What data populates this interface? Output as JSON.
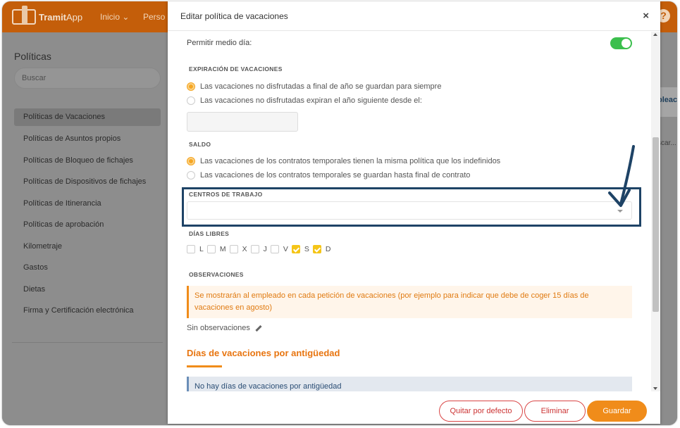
{
  "app": {
    "logo_text": "Tramit",
    "logo_text_suffix": "App",
    "nav": [
      "Inicio",
      "Perso"
    ],
    "help_icon": "question-icon"
  },
  "sidebar": {
    "title": "Políticas",
    "search_placeholder": "Buscar",
    "items": [
      {
        "label": "Políticas de Vacaciones",
        "active": true
      },
      {
        "label": "Políticas de Asuntos propios"
      },
      {
        "label": "Políticas de Bloqueo de fichajes"
      },
      {
        "label": "Políticas de Dispositivos de fichajes"
      },
      {
        "label": "Políticas de Itinerancia"
      },
      {
        "label": "Políticas de aprobación"
      },
      {
        "label": "Kilometraje"
      },
      {
        "label": "Gastos"
      },
      {
        "label": "Dietas"
      },
      {
        "label": "Firma y Certificación electrónica"
      }
    ]
  },
  "background_right": {
    "peek1": "pleac",
    "peek2": "scar..."
  },
  "modal": {
    "title": "Editar política de vacaciones",
    "close": "×",
    "medio_dia_label": "Permitir medio día:",
    "medio_dia_enabled": true,
    "expiracion": {
      "label": "EXPIRACIÓN DE VACACIONES",
      "option1": "Las vacaciones no disfrutadas a final de año se guardan para siempre",
      "option2": "Las vacaciones no disfrutadas expiran el año siguiente desde el:",
      "selected": 1,
      "date_value": ""
    },
    "saldo": {
      "label": "SALDO",
      "option1": "Las vacaciones de los contratos temporales tienen la misma política que los indefinidos",
      "option2": "Las vacaciones de los contratos temporales se guardan hasta final de contrato",
      "selected": 1
    },
    "centros": {
      "label": "CENTROS DE TRABAJO",
      "value": ""
    },
    "dias_libres": {
      "label": "DÍAS LIBRES",
      "days": [
        {
          "label": "L",
          "checked": false
        },
        {
          "label": "M",
          "checked": false
        },
        {
          "label": "X",
          "checked": false
        },
        {
          "label": "J",
          "checked": false
        },
        {
          "label": "V",
          "checked": false
        },
        {
          "label": "S",
          "checked": true
        },
        {
          "label": "D",
          "checked": true
        }
      ]
    },
    "observaciones": {
      "label": "OBSERVACIONES",
      "info": "Se mostrarán al empleado en cada petición de vacaciones (por ejemplo para indicar que debe de coger 15 días de vacaciones en agosto)",
      "value": "Sin observaciones"
    },
    "antiguedad": {
      "heading": "Días de vacaciones por antigüedad",
      "empty_text": "No hay días de vacaciones por antigüedad"
    },
    "buttons": {
      "quitar": "Quitar por defecto",
      "eliminar": "Eliminar",
      "guardar": "Guardar"
    }
  },
  "colors": {
    "brand_orange": "#f08c1a",
    "toggle_green": "#3bbf4d",
    "highlight_navy": "#1e4366"
  }
}
